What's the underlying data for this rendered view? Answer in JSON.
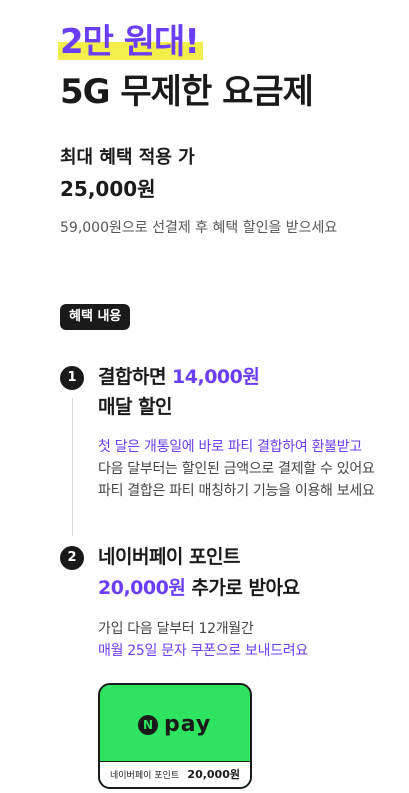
{
  "hero": {
    "highlight": "2만 원대!",
    "title": "5G 무제한 요금제"
  },
  "price": {
    "label": "최대 혜택 적용 가",
    "value": "25,000원",
    "note": "59,000원으로 선결제 후 혜택 할인을 받으세요"
  },
  "benefits": {
    "badge": "혜택 내용",
    "step1": {
      "number": "1",
      "title_prefix": "결합하면 ",
      "title_accent": "14,000원",
      "title_line2": "매달 할인",
      "desc_line1": "첫 달은 개통일에 바로 파티 결합하여 환불받고",
      "desc_line2": "다음 달부터는 할인된 금액으로 결제할 수 있어요",
      "desc_line3": "파티 결합은 파티 매칭하기 기능을 이용해 보세요"
    },
    "step2": {
      "number": "2",
      "title_line1": "네이버페이 포인트",
      "title_accent": "20,000원",
      "title_suffix": " 추가로 받아요",
      "desc_line1": "가입 다음 달부터 12개월간",
      "desc_line2": "매월 25일 문자 쿠폰으로 보내드려요"
    }
  },
  "card": {
    "logo_letter": "N",
    "logo_text": "pay",
    "label": "네이버페이 포인트",
    "amount": "20,000원",
    "colors": {
      "green": "#2ee35f",
      "accent": "#6b3df5",
      "highlight": "#f2ee4a"
    }
  }
}
